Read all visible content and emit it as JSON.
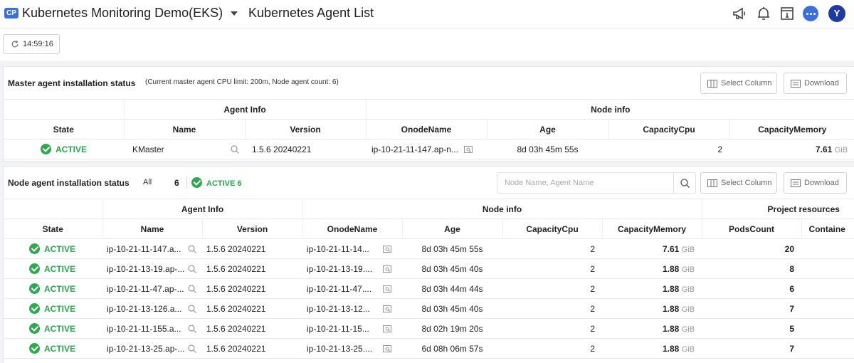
{
  "header": {
    "project_badge": "CP",
    "project_name": "Kubernetes Monitoring Demo(EKS)",
    "page_title": "Kubernetes Agent List",
    "avatar_initial": "Y"
  },
  "toolbar": {
    "refresh_time": "14:59:16"
  },
  "master": {
    "title": "Master agent installation status",
    "subtitle": "(Current master agent CPU limit: 200m, Node agent count: 6)",
    "select_column": "Select Column",
    "download": "Download",
    "group_headers": {
      "agent_info": "Agent Info",
      "node_info": "Node info"
    },
    "columns": [
      "State",
      "Name",
      "Version",
      "OnodeName",
      "Age",
      "CapacityCpu",
      "CapacityMemory"
    ],
    "row": {
      "state": "ACTIVE",
      "name": "KMaster",
      "version": "1.5.6 20240221",
      "onode": "ip-10-21-11-147.ap-n...",
      "age": "8d 03h 45m 55s",
      "cpu": "2",
      "memory": "7.61",
      "memory_unit": "GiB"
    }
  },
  "node": {
    "title": "Node agent installation status",
    "filter_all_label": "All",
    "filter_all_count": "6",
    "filter_active": "ACTIVE 6",
    "search_placeholder": "Node Name, Agent Name",
    "select_column": "Select Column",
    "download": "Download",
    "group_headers": {
      "agent_info": "Agent Info",
      "node_info": "Node info",
      "project_resources": "Project resources"
    },
    "columns": [
      "State",
      "Name",
      "Version",
      "OnodeName",
      "Age",
      "CapacityCpu",
      "CapacityMemory",
      "PodsCount",
      "Containe"
    ],
    "rows": [
      {
        "state": "ACTIVE",
        "name": "ip-10-21-11-147.a...",
        "version": "1.5.6 20240221",
        "onode": "ip-10-21-11-14...",
        "age": "8d 03h 45m 55s",
        "cpu": "2",
        "memory": "7.61",
        "unit": "GiB",
        "pods": "20"
      },
      {
        "state": "ACTIVE",
        "name": "ip-10-21-13-19.ap-...",
        "version": "1.5.6 20240221",
        "onode": "ip-10-21-13-19....",
        "age": "8d 03h 45m 40s",
        "cpu": "2",
        "memory": "1.88",
        "unit": "GiB",
        "pods": "8"
      },
      {
        "state": "ACTIVE",
        "name": "ip-10-21-11-47.ap-...",
        "version": "1.5.6 20240221",
        "onode": "ip-10-21-11-47....",
        "age": "8d 03h 44m 44s",
        "cpu": "2",
        "memory": "1.88",
        "unit": "GiB",
        "pods": "6"
      },
      {
        "state": "ACTIVE",
        "name": "ip-10-21-13-126.a...",
        "version": "1.5.6 20240221",
        "onode": "ip-10-21-13-12...",
        "age": "8d 03h 45m 40s",
        "cpu": "2",
        "memory": "1.88",
        "unit": "GiB",
        "pods": "7"
      },
      {
        "state": "ACTIVE",
        "name": "ip-10-21-11-155.a...",
        "version": "1.5.6 20240221",
        "onode": "ip-10-21-11-15...",
        "age": "8d 02h 19m 20s",
        "cpu": "2",
        "memory": "1.88",
        "unit": "GiB",
        "pods": "5"
      },
      {
        "state": "ACTIVE",
        "name": "ip-10-21-13-25.ap-...",
        "version": "1.5.6 20240221",
        "onode": "ip-10-21-13-25....",
        "age": "6d 08h 06m 57s",
        "cpu": "2",
        "memory": "1.88",
        "unit": "GiB",
        "pods": "7"
      }
    ]
  },
  "colors": {
    "accent": "#3b6fd9",
    "active_green": "#27a84a",
    "avatar": "#1f3aa3"
  },
  "icons": [
    "megaphone-icon",
    "bell-icon",
    "document-icon",
    "chat-icon",
    "refresh-icon",
    "search-icon",
    "columns-icon",
    "csv-icon",
    "node-detail-icon"
  ]
}
